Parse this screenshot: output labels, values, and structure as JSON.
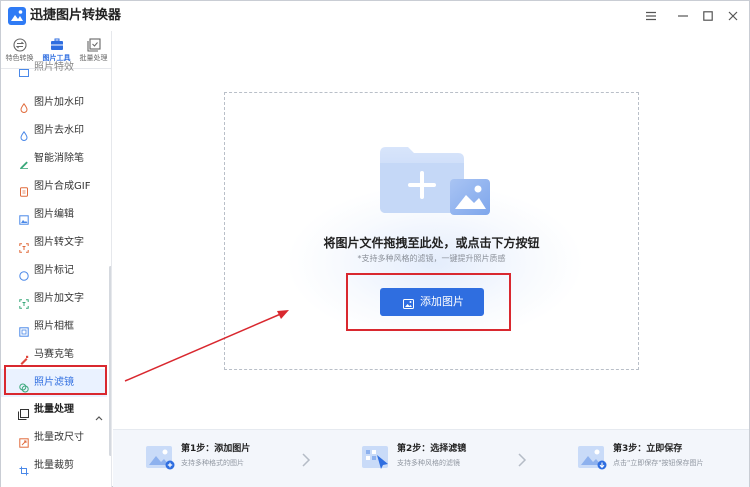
{
  "app": {
    "title": "迅捷图片转换器"
  },
  "sidebar": {
    "tabs": [
      {
        "label": "特色转换",
        "icon": "exchange-icon",
        "active": false
      },
      {
        "label": "图片工具",
        "icon": "toolbox-icon",
        "active": true
      },
      {
        "label": "批量处理",
        "icon": "batch-icon",
        "active": false
      }
    ],
    "items": [
      {
        "label": "照片特效",
        "icon": "effect-icon"
      },
      {
        "label": "图片加水印",
        "icon": "watermark-icon"
      },
      {
        "label": "图片去水印",
        "icon": "remove-watermark-icon"
      },
      {
        "label": "智能消除笔",
        "icon": "eraser-pen-icon"
      },
      {
        "label": "图片合成GIF",
        "icon": "gif-icon"
      },
      {
        "label": "图片编辑",
        "icon": "edit-image-icon"
      },
      {
        "label": "图片转文字",
        "icon": "ocr-icon"
      },
      {
        "label": "图片标记",
        "icon": "marker-icon"
      },
      {
        "label": "图片加文字",
        "icon": "add-text-icon"
      },
      {
        "label": "照片相框",
        "icon": "frame-icon"
      },
      {
        "label": "马赛克笔",
        "icon": "mosaic-pen-icon"
      },
      {
        "label": "照片滤镜",
        "icon": "filter-icon",
        "selected": true
      }
    ],
    "group": {
      "label": "批量处理",
      "icon": "batch-group-icon",
      "chevron": "chevron-up-icon"
    },
    "group_items": [
      {
        "label": "批量改尺寸",
        "icon": "resize-icon"
      },
      {
        "label": "批量裁剪",
        "icon": "crop-icon"
      }
    ]
  },
  "dropzone": {
    "title": "将图片文件拖拽至此处，或点击下方按钮",
    "subtitle": "*支持多种风格的滤镜，一键提升照片质感",
    "button_label": "添加图片"
  },
  "steps": [
    {
      "title": "第1步：添加图片",
      "desc": "支持多种格式的图片"
    },
    {
      "title": "第2步：选择滤镜",
      "desc": "支持多种风格的滤镜"
    },
    {
      "title": "第3步：立即保存",
      "desc": "点击\"立即保存\"按钮保存图片"
    }
  ],
  "colors": {
    "accent": "#2f6ee0",
    "annotation": "#d9282f",
    "selected_bg": "#eaf2ff",
    "steps_bg": "#f3f6fb"
  }
}
